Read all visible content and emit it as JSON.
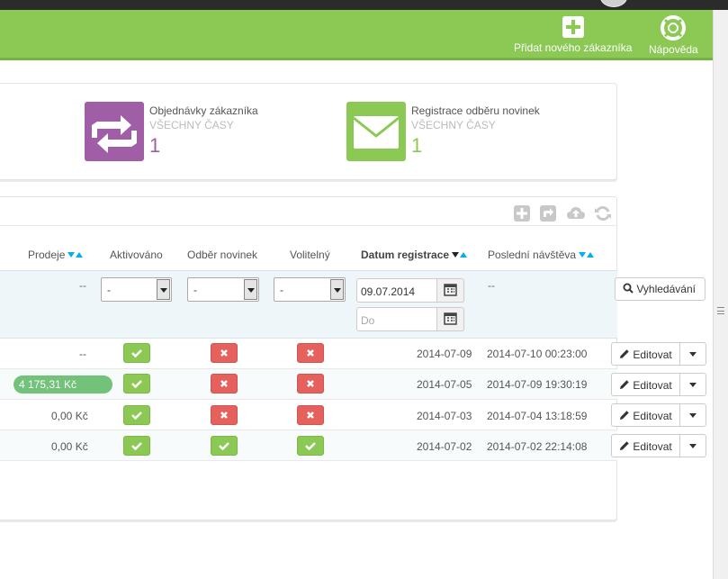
{
  "toolbar": {
    "add_customer_label": "Přidat nového zákazníka",
    "help_label": "Nápověda"
  },
  "kpis": [
    {
      "title": "Objednávky zákazníka",
      "period": "VŠECHNY ČASY",
      "value": "1",
      "color": "#a05ea6"
    },
    {
      "title": "Registrace odběru novinek",
      "period": "VŠECHNY ČASY",
      "value": "1",
      "color": "#8bc954"
    }
  ],
  "table": {
    "headers": {
      "sales": "Prodeje",
      "activated": "Aktivováno",
      "newsletter": "Odběr novinek",
      "optional": "Volitelný",
      "registered": "Datum registrace",
      "last_visit": "Poslední návštěva"
    },
    "filters": {
      "sales": "--",
      "activated": "-",
      "newsletter": "-",
      "optional": "-",
      "date_from": "09.07.2014",
      "date_to_placeholder": "Do",
      "last_visit": "--",
      "search_label": "Vyhledávání"
    },
    "rows": [
      {
        "sales": "--",
        "activated": true,
        "newsletter": false,
        "optional": false,
        "registered": "2014-07-09",
        "last_visit": "2014-07-10 00:23:00"
      },
      {
        "sales": "4 175,31 Kč",
        "activated": true,
        "newsletter": false,
        "optional": false,
        "registered": "2014-07-05",
        "last_visit": "2014-07-09 19:30:19"
      },
      {
        "sales": "0,00 Kč",
        "activated": true,
        "newsletter": false,
        "optional": false,
        "registered": "2014-07-03",
        "last_visit": "2014-07-04 13:18:59"
      },
      {
        "sales": "0,00 Kč",
        "activated": true,
        "newsletter": true,
        "optional": true,
        "registered": "2014-07-02",
        "last_visit": "2014-07-02 22:14:08"
      }
    ],
    "edit_label": "Editovat"
  },
  "colors": {
    "brand_green": "#8bc954",
    "ok": "#8bc954",
    "no": "#e4615e",
    "accent": "#00aff0"
  }
}
